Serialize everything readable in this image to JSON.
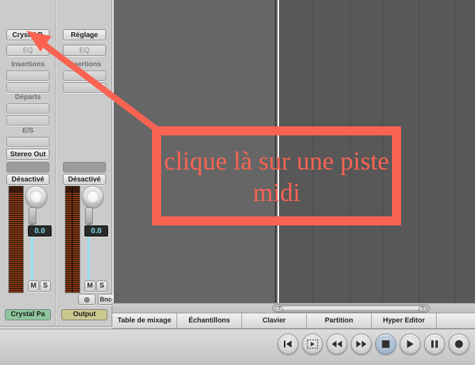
{
  "annotation": {
    "text": "clique là sur une piste midi",
    "color": "#fa6352",
    "arrow_label": "arrow-pointing-to-channel-strip-name"
  },
  "mixer": {
    "strips": [
      {
        "id": "crystal-channel-strip",
        "setting_button": "Crystal P.",
        "eq_button": "EQ",
        "inserts_label": "Insertions",
        "insert_slots": [
          "",
          ""
        ],
        "sends_label": "Départs",
        "send_slots": [
          "",
          ""
        ],
        "io_label": "E/S",
        "input_slot": "",
        "output_button": "Stereo Out",
        "group_slot": "",
        "automation_button": "Désactivé",
        "fader_value": "0.0",
        "mute_button": "M",
        "solo_button": "S",
        "track_name": "Crystal Pa",
        "track_color": "#8ec69c"
      },
      {
        "id": "output-channel-strip",
        "setting_button": "Réglage",
        "eq_button": "EQ",
        "inserts_label": "Insertions",
        "insert_slots": [
          "",
          ""
        ],
        "group_slot": "",
        "automation_button": "Désactivé",
        "fader_value": "0.0",
        "mute_button": "M",
        "solo_button": "S",
        "stereo_button": "◎",
        "bounce_button": "Bnce",
        "track_name": "Output",
        "track_color": "#cbc88f"
      }
    ]
  },
  "editor": {
    "background_left": "#666666",
    "background_right": "#585858",
    "playhead_color": "#ffffff",
    "scrollbar": {
      "left_grip": "⦀",
      "right_grip": "⦀"
    }
  },
  "tabs": [
    {
      "label": "Table de mixage"
    },
    {
      "label": "Échantillons"
    },
    {
      "label": "Clavier"
    },
    {
      "label": "Partition"
    },
    {
      "label": "Hyper Editor"
    }
  ],
  "transport": [
    {
      "name": "go-to-beginning-button",
      "icon": "skip-back-icon",
      "active": false
    },
    {
      "name": "cycle-play-button",
      "icon": "play-dashed-icon",
      "active": false
    },
    {
      "name": "rewind-button",
      "icon": "rewind-icon",
      "active": false
    },
    {
      "name": "forward-button",
      "icon": "fast-forward-icon",
      "active": false
    },
    {
      "name": "stop-button",
      "icon": "stop-icon",
      "active": true
    },
    {
      "name": "play-button",
      "icon": "play-icon",
      "active": false
    },
    {
      "name": "pause-button",
      "icon": "pause-icon",
      "active": false
    },
    {
      "name": "record-button",
      "icon": "record-icon",
      "active": false
    }
  ]
}
